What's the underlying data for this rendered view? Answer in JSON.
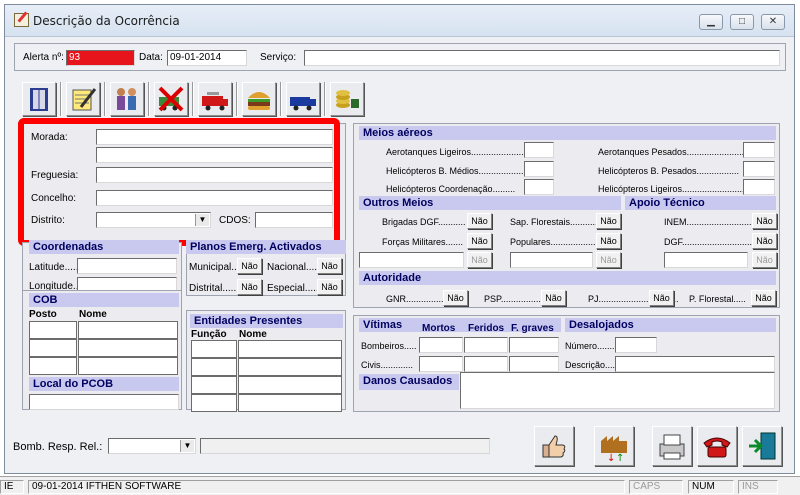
{
  "window": {
    "title": "Descrição da Ocorrência"
  },
  "header": {
    "alerta_label": "Alerta nº:",
    "alerta_value": "93",
    "data_label": "Data:",
    "data_value": "09-01-2014",
    "servico_label": "Serviço:"
  },
  "toolbar": {
    "icons": [
      "book-icon",
      "notepad-icon",
      "people-icon",
      "no-truck-icon",
      "truck-icon",
      "burger-icon",
      "transport-icon",
      "coins-icon"
    ]
  },
  "morada": {
    "morada_label": "Morada:",
    "freguesia_label": "Freguesia:",
    "concelho_label": "Concelho:",
    "distrito_label": "Distrito:",
    "cdos_label": "CDOS:"
  },
  "coordenadas": {
    "title": "Coordenadas",
    "latitude_label": "Latitude......",
    "longitude_label": "Longitude..."
  },
  "planos": {
    "title": "Planos Emerg. Activados",
    "municipal_label": "Municipal...",
    "nacional_label": "Nacional.....",
    "distrital_label": "Distrital........",
    "especial_label": "Especial......",
    "nao": "Não"
  },
  "cob": {
    "title": "COB",
    "col_posto": "Posto",
    "col_nome": "Nome",
    "local_title": "Local do PCOB"
  },
  "entidades": {
    "title": "Entidades Presentes",
    "col_funcao": "Função",
    "col_nome": "Nome"
  },
  "meios_aereos": {
    "title": "Meios aéreos",
    "left": [
      "Aerotanques Ligeiros.......................",
      "Helicópteros B. Médios...................",
      "Helicópteros Coordenação........."
    ],
    "right": [
      "Aerotanques Pesados.......................",
      "Helicópteros B. Pesados.................",
      "Helicópteros Ligeiros............................."
    ]
  },
  "outros_meios": {
    "title": "Outros Meios",
    "brigadas_label": "Brigadas DGF...........",
    "sap_label": "Sap. Florestais............",
    "forcas_label": "Forças Militares.......",
    "populares_label": "Populares........................",
    "nao": "Não"
  },
  "apoio_tecnico": {
    "title": "Apoio Técnico",
    "inem_label": "INEM..........................",
    "dgf_label": "DGF.............................",
    "nao": "Não"
  },
  "autoridade": {
    "title": "Autoridade",
    "gnr_label": "GNR...................",
    "psp_label": "PSP.................",
    "pj_label": "PJ................................",
    "pflorestal_label": "P. Florestal.....",
    "nao": "Não"
  },
  "vitimas": {
    "title": "Vítimas",
    "col_mortos": "Mortos",
    "col_feridos": "Feridos",
    "col_fgraves": "F. graves",
    "bombeiros_label": "Bombeiros.....",
    "civis_label": "Civis............."
  },
  "desalojados": {
    "title": "Desalojados",
    "numero_label": "Número.........",
    "descricao_label": "Descrição......"
  },
  "danos": {
    "title": "Danos Causados"
  },
  "bottom": {
    "bomb_label": "Bomb. Resp. Rel.:",
    "buttons": [
      "thumbs-up-icon",
      "factory-icon",
      "printer-icon",
      "telephone-icon",
      "exit-icon"
    ]
  },
  "statusbar": {
    "p0": "IE",
    "p1": "09-01-2014  IFTHEN SOFTWARE",
    "caps": "CAPS",
    "num": "NUM",
    "ins": "INS"
  },
  "colors": {
    "alerta_bg": "#e8141c",
    "highlight": "#ff0000",
    "section_bg": "#c9c9ef"
  }
}
